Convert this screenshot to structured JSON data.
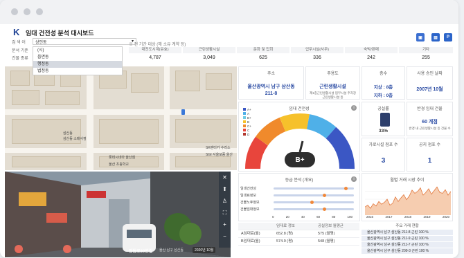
{
  "app": {
    "logo": "K",
    "title": "임대 건전성 분석 대시보드",
    "toolbar_icons": [
      "image-icon",
      "pdf-icon",
      "ppt-icon"
    ]
  },
  "filters": {
    "rows": [
      {
        "label": "검 색 어",
        "value": "상인동"
      },
      {
        "label": "분석 기준",
        "value": "(시)"
      },
      {
        "label": "건물 종류",
        "value": ""
      }
    ],
    "dropdown_options": [
      "(시)",
      "읍면동",
      "행정동",
      "법정동"
    ],
    "dropdown_selected_index": 2
  },
  "notice": "※ 전 기간 대상 (해 소유 계약 등)",
  "stats": [
    {
      "label": "대전도시계(유효)",
      "value": "4,787"
    },
    {
      "label": "근린생활시설",
      "value": "3,049"
    },
    {
      "label": "문화 및 집회",
      "value": "625"
    },
    {
      "label": "업무시설(사무)",
      "value": "336"
    },
    {
      "label": "숙박/판매",
      "value": "242"
    },
    {
      "label": "기타",
      "value": "255"
    }
  ],
  "map": {
    "labels": [
      "삼산동",
      "삼산동 소매서점",
      "SK렌터카 수리소",
      "롯데시네마 울산점",
      "울산 초등학교",
      "SGI 서울보증 울산"
    ]
  },
  "street": {
    "place": "장동로80번길",
    "sub": "울산 남구 삼산동",
    "date": "2020년 10월",
    "controls": [
      "close-icon",
      "up-icon",
      "person-icon",
      "fullscreen-icon",
      "plus-icon",
      "minus-icon"
    ]
  },
  "cards": {
    "address": {
      "title": "주소",
      "value": "울산광역시 남구 삼산동",
      "sub": "211-8"
    },
    "usage": {
      "title": "주용도",
      "value": "근린생활시설",
      "sub": "제1종근린생활시설 업무시설 주차장 근린생활시설 등"
    },
    "floors": {
      "title": "층수",
      "above": "지상 : 8층",
      "below": "지하 : 0층"
    },
    "approval": {
      "title": "사용 승인 날짜",
      "value": "2007년 10월"
    },
    "grade": {
      "title": "임대 건전성",
      "value": "B+",
      "legend": [
        "A+",
        "A",
        "B+",
        "B",
        "C+",
        "C",
        "D"
      ]
    },
    "vacancy": {
      "title": "공실률",
      "value": "33%"
    },
    "nearby": {
      "title": "반경 임대 건물",
      "value": "60 개점",
      "sub": "반경 내 근린생활시설 등 건물 수"
    },
    "count_a": {
      "title": "가로시설 점포 수",
      "value": "3"
    },
    "count_b": {
      "title": "공지 점포 수",
      "value": "1"
    }
  },
  "grade_analysis": {
    "title": "등급 분석 (개요)",
    "rows": [
      {
        "label": "임대건전성",
        "value": 90
      },
      {
        "label": "임대료정보",
        "value": 63
      },
      {
        "label": "건물노후정보",
        "value": 48
      },
      {
        "label": "건물임대정보",
        "value": 63
      }
    ],
    "axis": [
      "0",
      "20",
      "40",
      "60",
      "80",
      "100"
    ]
  },
  "trend": {
    "title": "월별 거래 시장 추이",
    "x_labels": [
      "2016",
      "2017",
      "2018",
      "2019",
      "2020"
    ],
    "values": [
      18,
      22,
      15,
      25,
      20,
      30,
      24,
      28,
      35,
      22,
      26,
      40,
      30,
      38,
      45,
      34,
      42,
      55,
      48,
      52,
      60,
      44,
      50,
      58,
      46,
      54,
      62,
      50,
      48,
      56,
      44,
      52
    ]
  },
  "table": {
    "head": [
      "",
      "임대료 정보",
      "공실정보 월평균"
    ],
    "rows": [
      [
        "A임대료(월)",
        "652.8 (평)",
        "575  (월평)"
      ],
      [
        "B임대료(월)",
        "574.9 (평)",
        "548  (월평)"
      ]
    ]
  },
  "ranking": {
    "title": "주요 거래 현황",
    "items": [
      "울산광역시 남구 삼산동 211-8 근린 100 %",
      "울산광역시 남구 삼산동 211-9 근린 100 %",
      "울산광역시 남구 삼산동 211-7 근린 100 %",
      "울산광역시 남구 삼산동 209-3 근린 100 %"
    ]
  }
}
